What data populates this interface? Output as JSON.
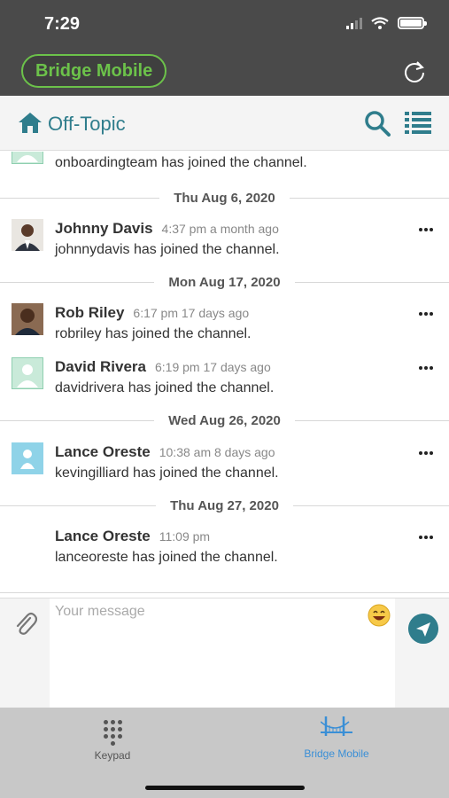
{
  "status_bar": {
    "time": "7:29"
  },
  "header": {
    "brand": "Bridge Mobile"
  },
  "channel": {
    "title": "Off-Topic"
  },
  "messages": [
    {
      "type": "message",
      "name": "",
      "time": "",
      "text": "onboardingteam has joined the channel.",
      "avatar": "default-green"
    },
    {
      "type": "date",
      "label": "Thu Aug 6, 2020"
    },
    {
      "type": "message",
      "name": "Johnny Davis",
      "time": "4:37 pm a month ago",
      "text": "johnnydavis has joined the channel.",
      "avatar": "photo"
    },
    {
      "type": "date",
      "label": "Mon Aug 17, 2020"
    },
    {
      "type": "message",
      "name": "Rob Riley",
      "time": "6:17 pm 17 days ago",
      "text": "robriley has joined the channel.",
      "avatar": "photo"
    },
    {
      "type": "message",
      "name": "David Rivera",
      "time": "6:19 pm 17 days ago",
      "text": "davidrivera has joined the channel.",
      "avatar": "default-green"
    },
    {
      "type": "date",
      "label": "Wed Aug 26, 2020"
    },
    {
      "type": "message",
      "name": "Lance Oreste",
      "time": "10:38 am 8 days ago",
      "text": "kevingilliard has joined the channel.",
      "avatar": "default-blue"
    },
    {
      "type": "date",
      "label": "Thu Aug 27, 2020"
    },
    {
      "type": "message",
      "name": "Lance Oreste",
      "time": "11:09 pm",
      "text": "lanceoreste has joined the channel.",
      "avatar": "none"
    }
  ],
  "composer": {
    "placeholder": "Your message"
  },
  "tabs": [
    {
      "label": "Keypad",
      "icon": "keypad-icon",
      "active": false
    },
    {
      "label": "Bridge Mobile",
      "icon": "bridge-icon",
      "active": true
    }
  ],
  "colors": {
    "accent": "#2f7d8c",
    "brand_green": "#6cc24a",
    "tab_active": "#3a8fd6"
  }
}
